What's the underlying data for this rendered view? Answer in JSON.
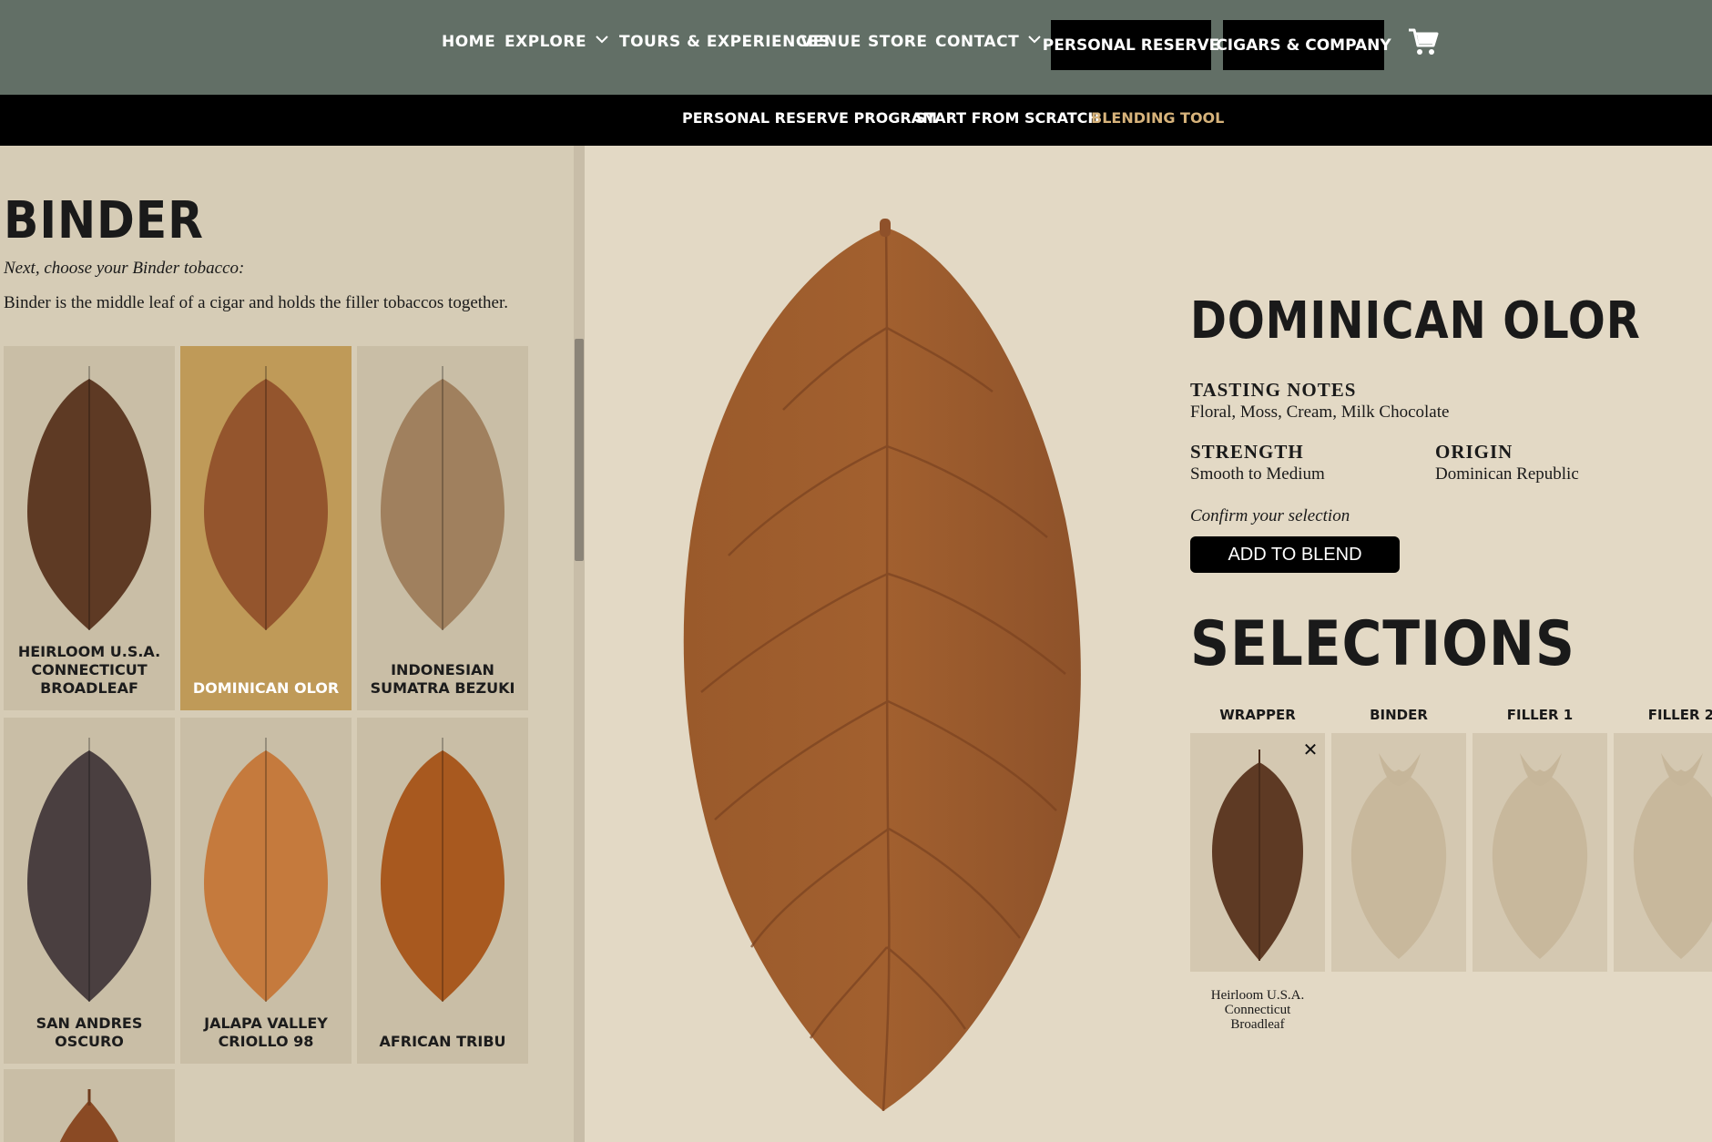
{
  "nav": {
    "home": "HOME",
    "explore": "EXPLORE",
    "tours": "TOURS & EXPERIENCES",
    "venue": "VENUE",
    "store": "STORE",
    "contact": "CONTACT",
    "personal_reserve": "PERSONAL RESERVE",
    "cigars_company": "CIGARS & COMPANY",
    "cart_icon": "cart-icon"
  },
  "subnav": {
    "program": "PERSONAL RESERVE PROGRAM",
    "scratch": "START FROM SCRATCH",
    "blending": "BLENDING TOOL"
  },
  "binder": {
    "heading": "BINDER",
    "instruction": "Next, choose your Binder tobacco:",
    "description": "Binder is the middle leaf of a cigar and holds the filler tobaccos together.",
    "options": [
      {
        "line1": "HEIRLOOM U.S.A.",
        "line2": "CONNECTICUT",
        "line3": "BROADLEAF",
        "color": "#5e3a24"
      },
      {
        "line1": "DOMINICAN OLOR",
        "line2": "",
        "line3": "",
        "color": "#94552d"
      },
      {
        "line1": "INDONESIAN",
        "line2": "SUMATRA BEZUKI",
        "line3": "",
        "color": "#a0805e"
      },
      {
        "line1": "SAN ANDRES",
        "line2": "OSCURO",
        "line3": "",
        "color": "#4a3f40"
      },
      {
        "line1": "JALAPA VALLEY",
        "line2": "CRIOLLO 98",
        "line3": "",
        "color": "#c57a3d"
      },
      {
        "line1": "AFRICAN TRIBU",
        "line2": "",
        "line3": "",
        "color": "#a8591f"
      }
    ]
  },
  "detail": {
    "name": "DOMINICAN OLOR",
    "tasting_label": "TASTING NOTES",
    "tasting_value": "Floral, Moss, Cream, Milk Chocolate",
    "strength_label": "STRENGTH",
    "strength_value": "Smooth to Medium",
    "origin_label": "ORIGIN",
    "origin_value": "Dominican Republic",
    "confirm": "Confirm your selection",
    "add_button": "ADD TO BLEND",
    "leaf_color": "#a2602f"
  },
  "selections": {
    "heading": "SELECTIONS",
    "slots": [
      {
        "label": "WRAPPER"
      },
      {
        "label": "BINDER"
      },
      {
        "label": "FILLER 1"
      },
      {
        "label": "FILLER 2"
      }
    ],
    "remove": "✕",
    "wrapper_caption": [
      "Heirloom U.S.A.",
      "Connecticut",
      "Broadleaf"
    ]
  }
}
